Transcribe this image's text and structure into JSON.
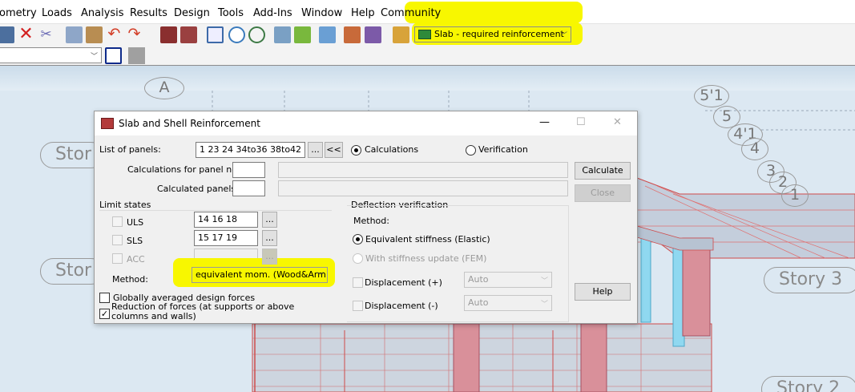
{
  "menu": {
    "items": [
      "ometry",
      "Loads",
      "Analysis",
      "Results",
      "Design",
      "Tools",
      "Add-Ins",
      "Window",
      "Help",
      "Community"
    ]
  },
  "toolbar": {
    "result_select": "Slab - required reinforcement",
    "icons": [
      "sheet-icon",
      "delete-icon",
      "cut-icon",
      "copy-icon",
      "paste-icon",
      "undo-icon",
      "redo-icon",
      "calculator-icon",
      "table-icon",
      "lock-icon",
      "zoom-icon",
      "zoom-window-icon",
      "layers-icon",
      "plant-icon",
      "section-icon",
      "edit-icon",
      "tools-icon",
      "structure-icon"
    ]
  },
  "toolbar2": {
    "combo_value": ""
  },
  "view": {
    "stories": [
      "Stor",
      "Stor",
      "Story 3",
      "Story 2"
    ],
    "axis_labels": [
      "A",
      "5'1",
      "5",
      "4'1",
      "4",
      "3",
      "2",
      "1"
    ]
  },
  "dialog": {
    "title": "Slab and Shell Reinforcement",
    "minimize": "—",
    "maximize": "☐",
    "close": "✕",
    "list_label": "List of panels:",
    "list_value": "1 23 24 34to36 38to42",
    "browse": "...",
    "collapse": "<<",
    "calc_radio": "Calculations",
    "verif_radio": "Verification",
    "calc_panel_label": "Calculations for panel no.:",
    "calculated_label": "Calculated panels:",
    "calculate_btn": "Calculate",
    "close_btn": "Close",
    "help_btn": "Help",
    "limit_states": "Limit states",
    "uls": "ULS",
    "sls": "SLS",
    "acc": "ACC",
    "uls_value": "14 16 18",
    "sls_value": "15 17 19",
    "method_label": "Method:",
    "method_value": "equivalent mom. (Wood&Arm",
    "globally_label": "Globally averaged design forces",
    "reduction_label": "Reduction of forces (at supports or above columns and walls)",
    "deflection_title": "Deflection verification",
    "defl_method_label": "Method:",
    "equiv_stiffness": "Equivalent stiffness (Elastic)",
    "with_stiffness": "With stiffness update (FEM)",
    "disp_plus": "Displacement (+)",
    "disp_minus": "Displacement (-)",
    "auto1": "Auto",
    "auto2": "Auto"
  },
  "colors": {
    "highlight": "#f8f700",
    "column_fill": "#d9909a",
    "wall_fill": "#8fd8f0"
  }
}
